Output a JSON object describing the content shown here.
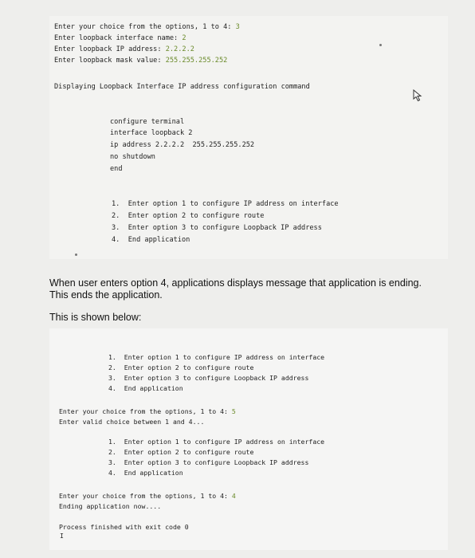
{
  "top": {
    "prompts": [
      {
        "label": "Enter your choice from the options, 1 to 4: ",
        "value": "3"
      },
      {
        "label": "Enter loopback interface name: ",
        "value": "2"
      },
      {
        "label": "Enter loopback IP address: ",
        "value": "2.2.2.2"
      },
      {
        "label": "Enter loopback mask value: ",
        "value": "255.255.255.252"
      }
    ],
    "display_heading": "Displaying Loopback Interface IP address configuration command",
    "commands": [
      "configure terminal",
      "interface loopback 2",
      "ip address 2.2.2.2  255.255.255.252",
      "no shutdown",
      "end"
    ],
    "menu": [
      {
        "num": "1.",
        "text": "Enter option 1 to configure IP address on interface"
      },
      {
        "num": "2.",
        "text": "Enter option 2 to configure route"
      },
      {
        "num": "3.",
        "text": "Enter option 3 to configure Loopback IP address"
      },
      {
        "num": "4.",
        "text": "End application"
      }
    ]
  },
  "prose": {
    "line1": "When user enters option 4, applications displays message that application is ending.",
    "line2": "This ends the application.",
    "line3": "This is shown below:"
  },
  "bottom": {
    "menu1": [
      {
        "num": "1.",
        "text": "Enter option 1 to configure IP address on interface"
      },
      {
        "num": "2.",
        "text": "Enter option 2 to configure route"
      },
      {
        "num": "3.",
        "text": "Enter option 3 to configure Loopback IP address"
      },
      {
        "num": "4.",
        "text": "End application"
      }
    ],
    "prompt1": {
      "label": "Enter your choice from the options, 1 to 4: ",
      "value": "5"
    },
    "invalid_msg": "Enter valid choice between 1 and 4...",
    "menu2": [
      {
        "num": "1.",
        "text": "Enter option 1 to configure IP address on interface"
      },
      {
        "num": "2.",
        "text": "Enter option 2 to configure route"
      },
      {
        "num": "3.",
        "text": "Enter option 3 to configure Loopback IP address"
      },
      {
        "num": "4.",
        "text": "End application"
      }
    ],
    "prompt2": {
      "label": "Enter your choice from the options, 1 to 4: ",
      "value": "4"
    },
    "ending_msg": "Ending application now....",
    "exit_msg": "Process finished with exit code 0",
    "caret": "I"
  },
  "colors": {
    "value_text": "#6a8a2a",
    "console_bg": "#f3f3f1"
  },
  "icons": {
    "cursor": "mouse-pointer-icon"
  }
}
